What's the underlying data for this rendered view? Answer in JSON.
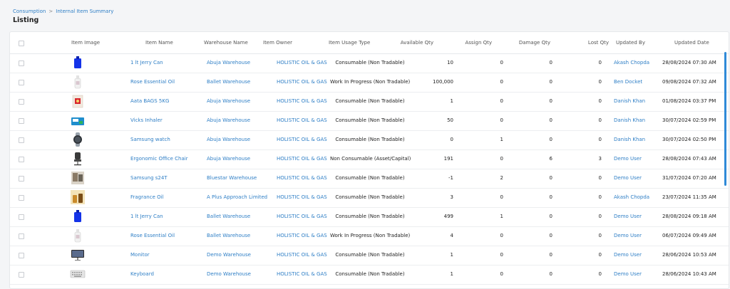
{
  "breadcrumb": {
    "parent": "Consumption",
    "separator": ">",
    "current": "Internal Item Summary"
  },
  "page_title": "Listing",
  "columns": [
    "Item Image",
    "Item Name",
    "Warehouse Name",
    "Item Owner",
    "Item Usage Type",
    "Available Qty",
    "Assign Qty",
    "Damage Qty",
    "Lost Qty",
    "Updated By",
    "Updated Date"
  ],
  "rows": [
    {
      "image": "blue-jerry-can-icon",
      "name": "1 lt Jerry Can",
      "warehouse": "Abuja Warehouse",
      "owner": "HOLISTIC OIL & GAS",
      "usage": "Consumable (Non Tradable)",
      "available": "10",
      "assign": "0",
      "damage": "0",
      "lost": "0",
      "updated_by": "Akash Chopda",
      "updated_date": "28/08/2024 07:30 AM"
    },
    {
      "image": "white-bottle-icon",
      "name": "Rose Essential Oil",
      "warehouse": "Ballet Warehouse",
      "owner": "HOLISTIC OIL & GAS",
      "usage": "Work In Progress (Non Tradable)",
      "available": "100,000",
      "assign": "0",
      "damage": "0",
      "lost": "0",
      "updated_by": "Ben Docket",
      "updated_date": "09/08/2024 07:32 AM"
    },
    {
      "image": "red-bag-icon",
      "name": "Aata BAGS 5KG",
      "warehouse": "Abuja Warehouse",
      "owner": "HOLISTIC OIL & GAS",
      "usage": "Consumable (Non Tradable)",
      "available": "1",
      "assign": "0",
      "damage": "0",
      "lost": "0",
      "updated_by": "Danish Khan",
      "updated_date": "01/08/2024 03:37 PM"
    },
    {
      "image": "inhaler-box-icon",
      "name": "Vicks Inhaler",
      "warehouse": "Abuja Warehouse",
      "owner": "HOLISTIC OIL & GAS",
      "usage": "Consumable (Non Tradable)",
      "available": "50",
      "assign": "0",
      "damage": "0",
      "lost": "0",
      "updated_by": "Danish Khan",
      "updated_date": "30/07/2024 02:59 PM"
    },
    {
      "image": "smartwatch-icon",
      "name": "Samsung watch",
      "warehouse": "Abuja Warehouse",
      "owner": "HOLISTIC OIL & GAS",
      "usage": "Consumable (Non Tradable)",
      "available": "0",
      "assign": "1",
      "damage": "0",
      "lost": "0",
      "updated_by": "Danish Khan",
      "updated_date": "30/07/2024 02:50 PM"
    },
    {
      "image": "office-chair-icon",
      "name": "Ergonomic Office Chair",
      "warehouse": "Abuja Warehouse",
      "owner": "HOLISTIC OIL & GAS",
      "usage": "Non Consumable (Asset/Capital)",
      "available": "191",
      "assign": "0",
      "damage": "6",
      "lost": "3",
      "updated_by": "Demo User",
      "updated_date": "28/08/2024 07:43 AM"
    },
    {
      "image": "tv-stand-icon",
      "name": "Samsung s24T",
      "warehouse": "Bluestar Warehouse",
      "owner": "HOLISTIC OIL & GAS",
      "usage": "Consumable (Non Tradable)",
      "available": "-1",
      "assign": "2",
      "damage": "0",
      "lost": "0",
      "updated_by": "Demo User",
      "updated_date": "31/07/2024 07:20 AM"
    },
    {
      "image": "fragrance-bottle-icon",
      "name": "Fragrance Oil",
      "warehouse": "A Plus Approach Limited",
      "owner": "HOLISTIC OIL & GAS",
      "usage": "Consumable (Non Tradable)",
      "available": "3",
      "assign": "0",
      "damage": "0",
      "lost": "0",
      "updated_by": "Akash Chopda",
      "updated_date": "23/07/2024 11:35 AM"
    },
    {
      "image": "blue-jerry-can-icon",
      "name": "1 lt Jerry Can",
      "warehouse": "Ballet Warehouse",
      "owner": "HOLISTIC OIL & GAS",
      "usage": "Consumable (Non Tradable)",
      "available": "499",
      "assign": "1",
      "damage": "0",
      "lost": "0",
      "updated_by": "Demo User",
      "updated_date": "28/08/2024 09:18 AM"
    },
    {
      "image": "white-bottle-icon",
      "name": "Rose Essential Oil",
      "warehouse": "Ballet Warehouse",
      "owner": "HOLISTIC OIL & GAS",
      "usage": "Work In Progress (Non Tradable)",
      "available": "4",
      "assign": "0",
      "damage": "0",
      "lost": "0",
      "updated_by": "Demo User",
      "updated_date": "06/07/2024 09:49 AM"
    },
    {
      "image": "monitor-icon",
      "name": "Monitor",
      "warehouse": "Demo Warehouse",
      "owner": "HOLISTIC OIL & GAS",
      "usage": "Consumable (Non Tradable)",
      "available": "1",
      "assign": "0",
      "damage": "0",
      "lost": "0",
      "updated_by": "Demo User",
      "updated_date": "28/06/2024 10:53 AM"
    },
    {
      "image": "keyboard-icon",
      "name": "Keyboard",
      "warehouse": "Demo Warehouse",
      "owner": "HOLISTIC OIL & GAS",
      "usage": "Consumable (Non Tradable)",
      "available": "1",
      "assign": "0",
      "damage": "0",
      "lost": "0",
      "updated_by": "Demo User",
      "updated_date": "28/06/2024 10:43 AM"
    }
  ],
  "colors": {
    "link": "#2f7fc6",
    "scrollbar": "#2f8ad8",
    "text": "#222222",
    "header_text": "#555555"
  }
}
